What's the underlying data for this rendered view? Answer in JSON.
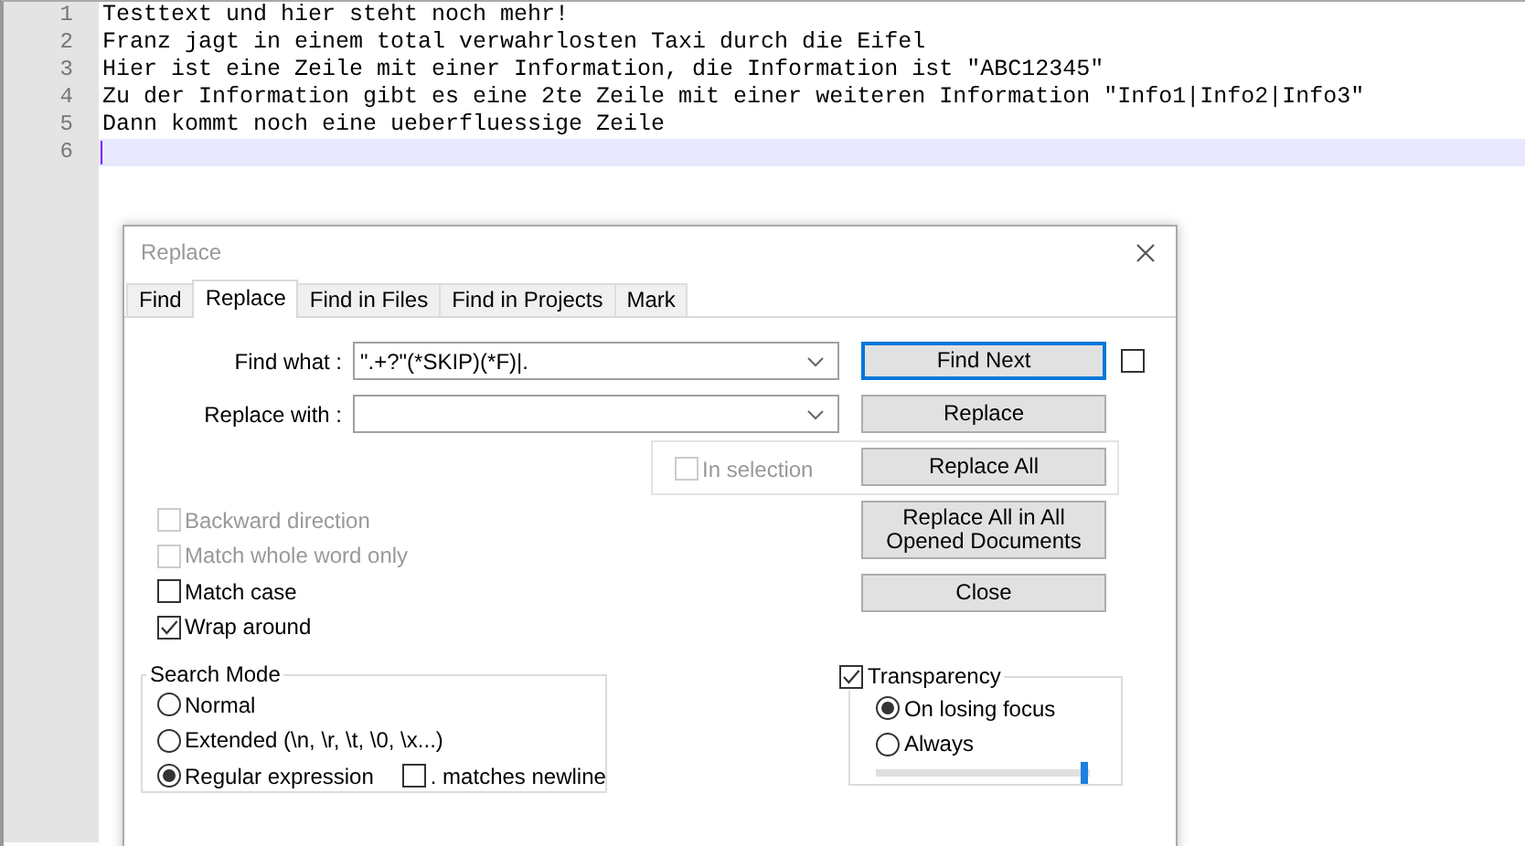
{
  "editor": {
    "lines": [
      {
        "number": "1",
        "text": "Testtext und hier steht noch mehr!",
        "current": false
      },
      {
        "number": "2",
        "text": "Franz jagt in einem total verwahrlosten Taxi durch die Eifel",
        "current": false
      },
      {
        "number": "3",
        "text": "Hier ist eine Zeile mit einer Information, die Information ist \"ABC12345\"",
        "current": false
      },
      {
        "number": "4",
        "text": "Zu der Information gibt es eine 2te Zeile mit einer weiteren Information \"Info1|Info2|Info3\"",
        "current": false
      },
      {
        "number": "5",
        "text": "Dann kommt noch eine ueberfluessige Zeile",
        "current": false
      },
      {
        "number": "6",
        "current": true
      }
    ]
  },
  "dialog": {
    "title": "Replace",
    "tabs": [
      {
        "label": "Find",
        "selected": false
      },
      {
        "label": "Replace",
        "selected": true
      },
      {
        "label": "Find in Files",
        "selected": false
      },
      {
        "label": "Find in Projects",
        "selected": false
      },
      {
        "label": "Mark",
        "selected": false
      }
    ],
    "find_what": {
      "label": "Find what :",
      "value": "\".+?\"(*SKIP)(*F)|."
    },
    "replace_with": {
      "label": "Replace with :"
    },
    "in_selection": {
      "label": "In selection",
      "checked": false,
      "disabled": true
    },
    "buttons": [
      {
        "label": "Find Next",
        "focused": true
      },
      {
        "label": "Replace",
        "focused": false
      },
      {
        "label": "Replace All",
        "focused": false
      },
      {
        "label": "Replace All in All Opened Documents",
        "focused": false
      },
      {
        "label": "Close",
        "focused": false
      }
    ],
    "side_checkbox": {
      "checked": false
    },
    "options": [
      {
        "label": "Backward direction",
        "checked": false,
        "disabled": true
      },
      {
        "label": "Match whole word only",
        "checked": false,
        "disabled": true
      },
      {
        "label": "Match case",
        "checked": false,
        "disabled": false
      },
      {
        "label": "Wrap around",
        "checked": true,
        "disabled": false
      }
    ],
    "search_mode": {
      "title": "Search Mode",
      "modes": [
        {
          "label": "Normal",
          "selected": false
        },
        {
          "label": "Extended (\\n, \\r, \\t, \\0, \\x...)",
          "selected": false
        },
        {
          "label": "Regular expression",
          "selected": true
        }
      ],
      "dot_newline": {
        "label": ". matches newline",
        "checked": false
      }
    },
    "transparency": {
      "label": "Transparency",
      "checked": true,
      "modes": [
        {
          "label": "On losing focus",
          "selected": true
        },
        {
          "label": "Always",
          "selected": false
        }
      ],
      "slider": {
        "level": 0.97
      }
    }
  }
}
